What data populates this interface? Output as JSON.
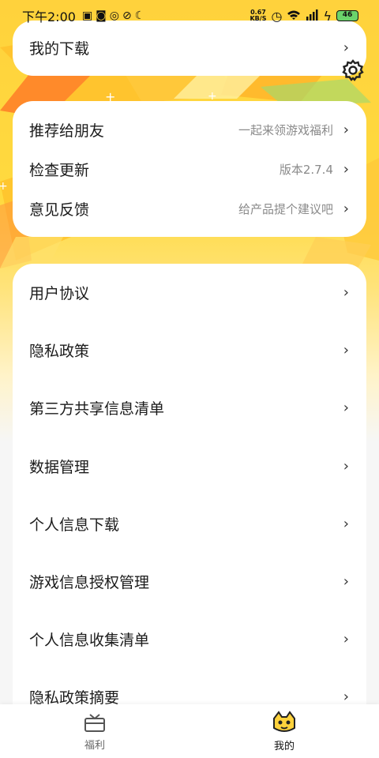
{
  "status_bar": {
    "time": "下午2:00",
    "net_speed_value": "0.67",
    "net_speed_unit": "KB/S",
    "battery": "46"
  },
  "top_card": {
    "label": "我的下载"
  },
  "settings_icon": "gear-icon",
  "middle_card": {
    "items": [
      {
        "label": "推荐给朋友",
        "hint": "一起来领游戏福利"
      },
      {
        "label": "检查更新",
        "hint": "版本2.7.4"
      },
      {
        "label": "意见反馈",
        "hint": "给产品提个建议吧"
      }
    ]
  },
  "policy_card": {
    "items": [
      {
        "label": "用户协议"
      },
      {
        "label": "隐私政策"
      },
      {
        "label": "第三方共享信息清单"
      },
      {
        "label": "数据管理"
      },
      {
        "label": "个人信息下载"
      },
      {
        "label": "游戏信息授权管理"
      },
      {
        "label": "个人信息收集清单"
      },
      {
        "label": "隐私政策摘要"
      }
    ]
  },
  "chevron": "›",
  "bottom_nav": {
    "tabs": [
      {
        "label": "福利",
        "icon": "gift-box-icon",
        "active": false
      },
      {
        "label": "我的",
        "icon": "game-mascot-icon",
        "active": true
      }
    ]
  },
  "colors": {
    "accent_yellow": "#ffd23c",
    "accent_orange": "#ff8a2a",
    "text_primary": "#1b1b1b",
    "text_hint": "#8a8a8a"
  }
}
